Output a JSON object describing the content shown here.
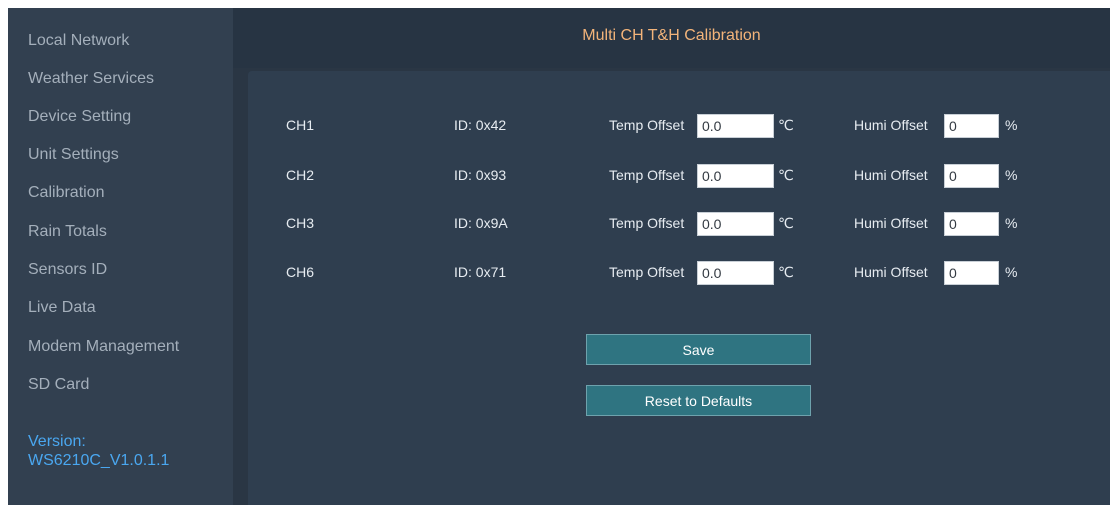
{
  "sidebar": {
    "items": [
      {
        "label": "Local Network"
      },
      {
        "label": "Weather Services"
      },
      {
        "label": "Device Setting"
      },
      {
        "label": "Unit Settings"
      },
      {
        "label": "Calibration"
      },
      {
        "label": "Rain Totals"
      },
      {
        "label": "Sensors ID"
      },
      {
        "label": "Live Data"
      },
      {
        "label": "Modem Management"
      },
      {
        "label": "SD Card"
      }
    ],
    "version_label": "Version:",
    "version_value": "WS6210C_V1.0.1.1"
  },
  "header": {
    "title": "Multi CH T&H Calibration"
  },
  "labels": {
    "temp_offset": "Temp Offset",
    "temp_unit": "℃",
    "humi_offset": "Humi Offset",
    "humi_unit": "%"
  },
  "channels": [
    {
      "channel": "CH1",
      "id": "ID: 0x42",
      "temp_offset": "0.0",
      "humi_offset": "0"
    },
    {
      "channel": "CH2",
      "id": "ID: 0x93",
      "temp_offset": "0.0",
      "humi_offset": "0"
    },
    {
      "channel": "CH3",
      "id": "ID: 0x9A",
      "temp_offset": "0.0",
      "humi_offset": "0"
    },
    {
      "channel": "CH6",
      "id": "ID: 0x71",
      "temp_offset": "0.0",
      "humi_offset": "0"
    }
  ],
  "buttons": {
    "save": "Save",
    "reset": "Reset to Defaults"
  },
  "colors": {
    "accent_title": "#f3b47a",
    "version_link": "#4aa7f0",
    "button": "#2f7481"
  }
}
